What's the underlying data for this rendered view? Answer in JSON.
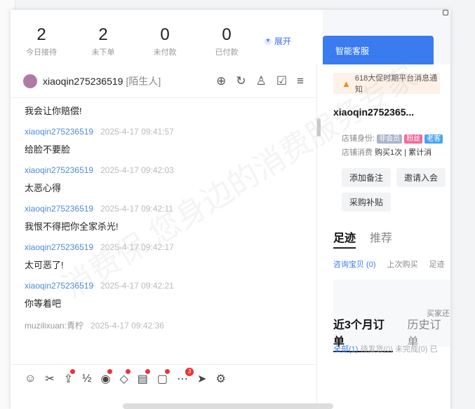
{
  "stats": [
    {
      "num": "2",
      "label": "今日接待"
    },
    {
      "num": "2",
      "label": "未下单"
    },
    {
      "num": "0",
      "label": "未付款"
    },
    {
      "num": "0",
      "label": "已付款"
    }
  ],
  "expand_label": "展开",
  "chat": {
    "user": "xiaoqin275236519",
    "user_tag": "[陌生人]",
    "messages": [
      {
        "sender": "",
        "time": "",
        "text": "我会让你赔偿!"
      },
      {
        "sender": "xiaoqin275236519",
        "time": "2025-4-17 09:41:57",
        "text": "给脸不要脸"
      },
      {
        "sender": "xiaoqin275236519",
        "time": "2025-4-17 09:42:03",
        "text": "太恶心得"
      },
      {
        "sender": "xiaoqin275236519",
        "time": "2025-4-17 09:42:11",
        "text": "我恨不得把你全家杀光!"
      },
      {
        "sender": "xiaoqin275236519",
        "time": "2025-4-17 09:42:17",
        "text": "太可恶了!"
      },
      {
        "sender": "xiaoqin275236519",
        "time": "2025-4-17 09:42:21",
        "text": "你等着吧"
      },
      {
        "sender": "muzilixuan:青柠",
        "time": "2025-4-17 09:42:36",
        "text": ""
      }
    ]
  },
  "right": {
    "tab": "智能客服",
    "notice": "618大促时期平台消息通知",
    "customer": "xiaoqin2752365...",
    "identity_label": "店铺身份:",
    "chips": [
      {
        "text": "非会员",
        "color": "#aab4c8"
      },
      {
        "text": "粉丝",
        "color": "#f06a9a"
      },
      {
        "text": "老客",
        "color": "#4aa3f0"
      }
    ],
    "spend_label": "店铺消费",
    "spend_value": "购买1次 | 累计消",
    "buttons": [
      "添加备注",
      "邀请入会",
      "采购补贴"
    ],
    "tab_footprint": "足迹",
    "tab_recommend": "推荐",
    "sub_consult": "咨询宝贝 (0)",
    "sub_last": "上次购买",
    "sub_more": "足迹",
    "empty_text": "买家还",
    "tab_orders3m": "近3个月订单",
    "tab_history": "历史订单",
    "order_all": "全部(1)",
    "order_rest": "待发货(0) 未完成(0) 已"
  },
  "watermark": "消费保 您身边的消费服务专家"
}
